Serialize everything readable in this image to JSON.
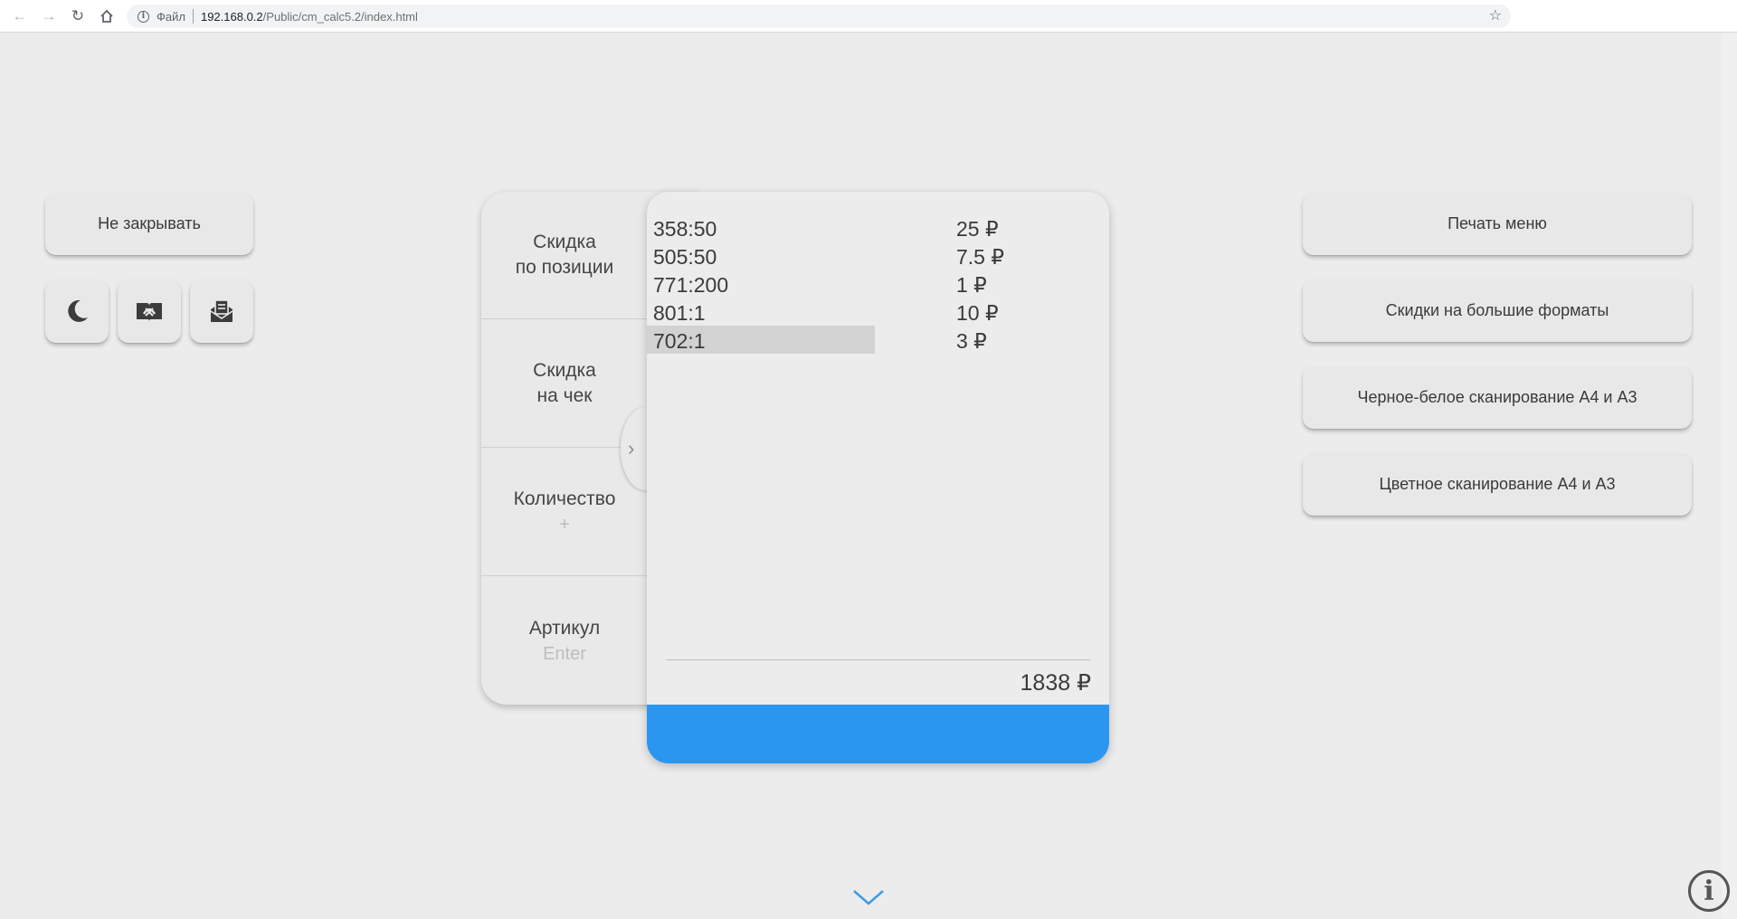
{
  "browser": {
    "scheme_label": "Файл",
    "url_host": "192.168.0.2",
    "url_path": "/Public/cm_calc5.2/index.html",
    "icons": [
      "back-arrow-icon",
      "forward-arrow-icon",
      "reload-icon",
      "home-icon",
      "info-icon",
      "star-icon"
    ]
  },
  "left": {
    "keep_open_label": "Не закрывать",
    "icon_buttons": [
      "moon-icon",
      "book-icon",
      "mail-icon"
    ]
  },
  "tabs": [
    {
      "line1": "Скидка",
      "line2": "по позиции",
      "hint": ""
    },
    {
      "line1": "Скидка",
      "line2": "на чек",
      "hint": ""
    },
    {
      "line1": "Количество",
      "line2": "",
      "hint": "+"
    },
    {
      "line1": "Артикул",
      "line2": "",
      "hint": "Enter"
    }
  ],
  "receipt": {
    "items": [
      {
        "code": "358:50",
        "price": "25 ₽"
      },
      {
        "code": "505:50",
        "price": "7.5 ₽"
      },
      {
        "code": "771:200",
        "price": "1 ₽"
      },
      {
        "code": "801:1",
        "price": "10 ₽"
      },
      {
        "code": "702:1",
        "price": "3 ₽"
      }
    ],
    "selected_index": 4,
    "total": "1838 ₽",
    "accent_color": "#2b96f0"
  },
  "right": {
    "buttons": [
      "Печать меню",
      "Скидки на большие форматы",
      "Черное-белое сканирование А4 и А3",
      "Цветное сканирование А4 и А3"
    ]
  }
}
